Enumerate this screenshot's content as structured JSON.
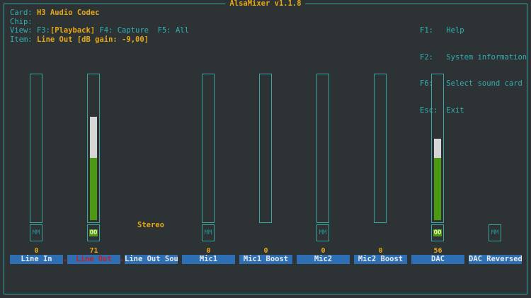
{
  "window": {
    "title": "AlsaMixer v1.1.8"
  },
  "info": {
    "card_label": "Card:",
    "card_value": "H3 Audio Codec",
    "chip_label": "Chip:",
    "chip_value": "",
    "view_label": "View:",
    "view_f3": "F3:",
    "view_playback": "[Playback]",
    "view_f4": "F4: Capture",
    "view_f5": "F5: All",
    "item_label": "Item:",
    "item_value": "Line Out [dB gain: -9,00]"
  },
  "help": [
    {
      "key": "F1:",
      "text": "Help"
    },
    {
      "key": "F2:",
      "text": "System information"
    },
    {
      "key": "F6:",
      "text": "Select sound card"
    },
    {
      "key": "Esc:",
      "text": "Exit"
    }
  ],
  "controls": [
    {
      "name": "Line In",
      "value": "0",
      "switch": "MM",
      "has_bar": true,
      "level": 0
    },
    {
      "name": "Line Out",
      "value": "71",
      "switch": "OO",
      "has_bar": true,
      "level": 0.71,
      "selected": true
    },
    {
      "name": "Line Out Sou",
      "value": "",
      "enum": "Stereo",
      "has_bar": false
    },
    {
      "name": "Mic1",
      "value": "0",
      "switch": "MM",
      "has_bar": true,
      "level": 0
    },
    {
      "name": "Mic1 Boost",
      "value": "0",
      "has_bar": true,
      "level": 0
    },
    {
      "name": "Mic2",
      "value": "0",
      "switch": "MM",
      "has_bar": true,
      "level": 0
    },
    {
      "name": "Mic2 Boost",
      "value": "0",
      "has_bar": true,
      "level": 0
    },
    {
      "name": "DAC",
      "value": "56",
      "switch": "OO",
      "has_bar": true,
      "level": 0.56
    },
    {
      "name": "DAC Reversed",
      "value": "",
      "switch": "MM",
      "has_bar": false
    }
  ],
  "colors": {
    "frame": "#3aa6a2",
    "accent": "#e6a817",
    "label": "#33b1b1",
    "green": "#4c9a12",
    "name_bg": "#2e6fb3",
    "selected": "#c81e1e"
  }
}
